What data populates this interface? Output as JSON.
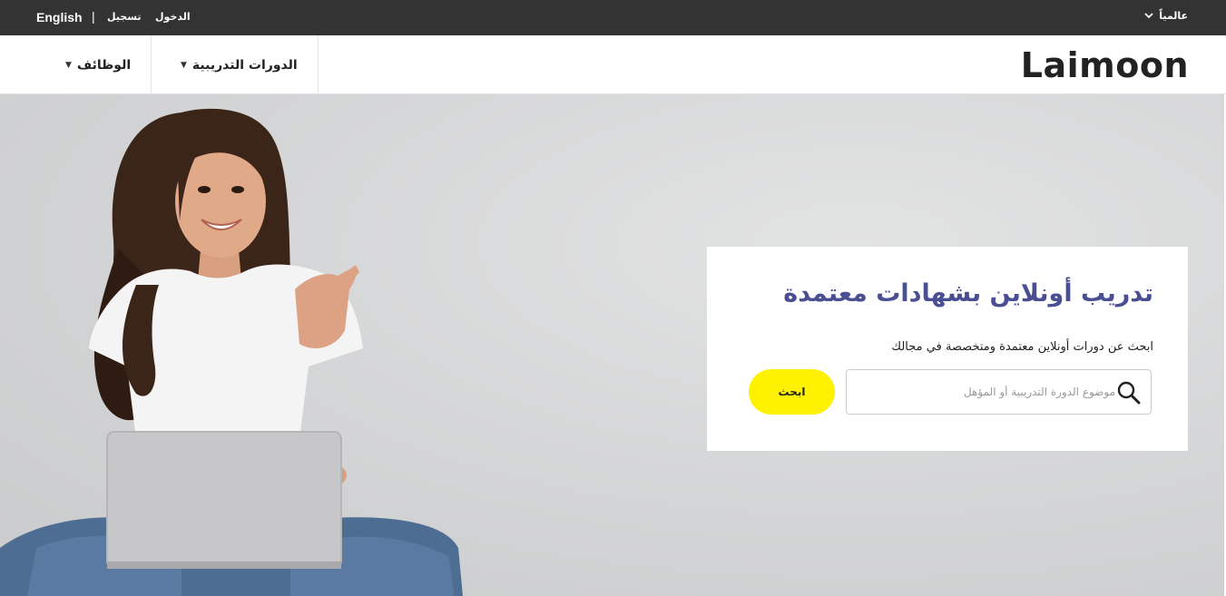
{
  "topbar": {
    "language_link": "English",
    "separator": "|",
    "register_link": "تسجيل",
    "login_link": "الدخول",
    "region_selector": "عالمياً",
    "region_icon": "chevron-down-icon"
  },
  "nav": {
    "jobs_label": "الوظائف",
    "courses_label": "الدورات التدريبية",
    "dropdown_icon": "caret-down-icon",
    "logo_text": "Laimoon"
  },
  "hero": {
    "headline": "تدريب أونلاين بشهادات معتمدة",
    "subheadline": "ابحث عن دورات أونلاين معتمدة ومتخصصة في مجالك",
    "search": {
      "placeholder": "موضوع الدورة التدريبية أو المؤهل",
      "value": "",
      "icon": "search-icon"
    },
    "search_button_label": "ابحث"
  },
  "colors": {
    "topbar_bg": "#333333",
    "headline_color": "#4a4f93",
    "search_button_bg": "#fff200",
    "hero_bg": "#d6d7d8"
  }
}
